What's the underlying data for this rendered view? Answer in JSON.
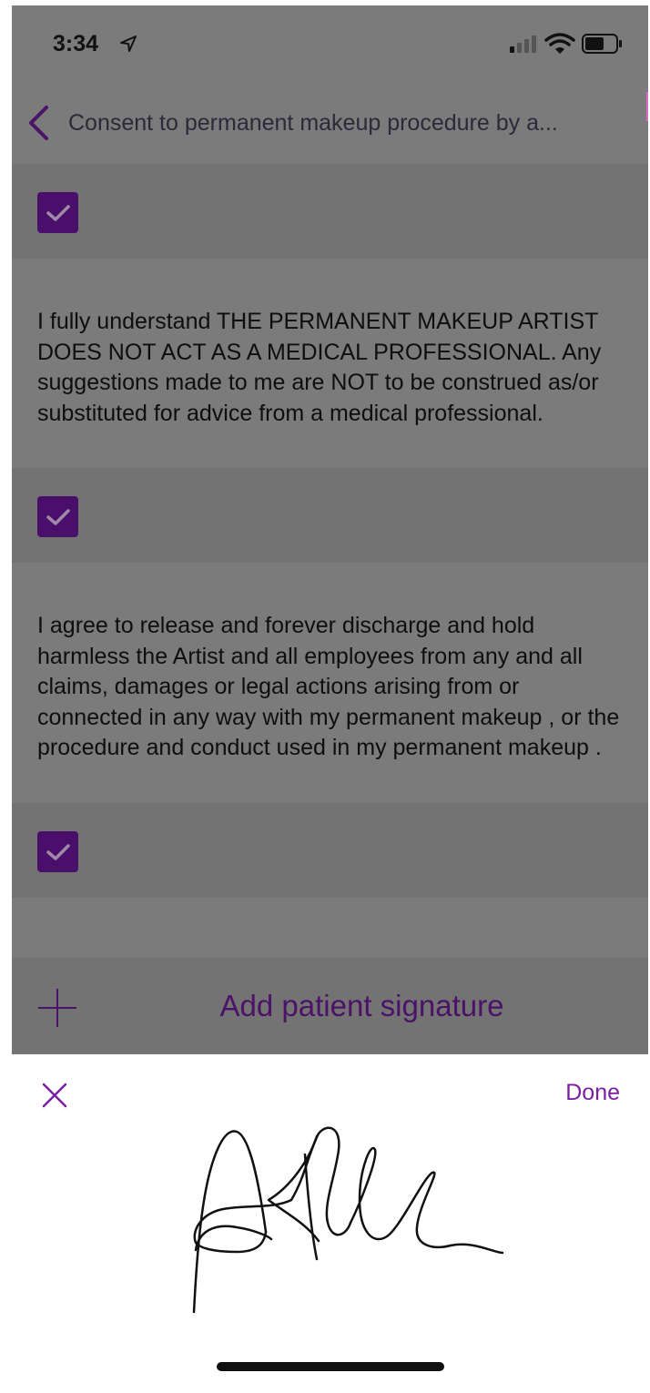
{
  "status_bar": {
    "time": "3:34"
  },
  "navbar": {
    "title": "Consent to permanent makeup procedure by a..."
  },
  "sections": [
    {
      "checked": true
    },
    {
      "text": "I fully understand THE PERMANENT MAKEUP ARTIST DOES NOT ACT AS A MEDICAL PROFESSIONAL. Any suggestions made to me are NOT to be construed as/or substituted for advice from a medical professional.",
      "checked": true
    },
    {
      "text": "I agree to release and forever discharge and hold harmless the Artist and all employees from any and all claims, damages or legal actions arising from or connected in any way with my permanent makeup , or the procedure and conduct used in my permanent makeup .",
      "checked": true
    }
  ],
  "signature_row": {
    "label": "Add patient signature"
  },
  "signature_pad": {
    "done_label": "Done"
  },
  "colors": {
    "accent": "#7a1fa3",
    "checkbox": "#4a0f6b",
    "overlay": "#7b7b7b"
  }
}
